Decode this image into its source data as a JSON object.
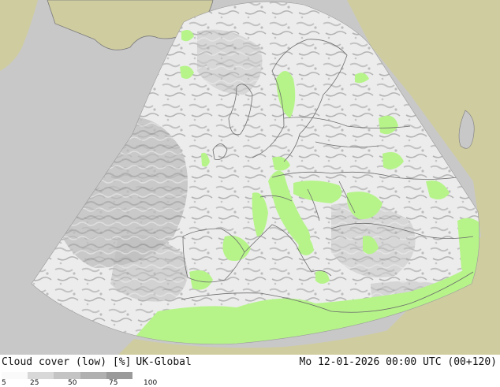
{
  "title": "Cloud cover (low) [%]",
  "model": "UK-Global",
  "datetime": "Mo 12-01-2026 00:00 UTC (00+120)",
  "legend": {
    "labels": [
      "5",
      "25",
      "50",
      "75",
      "100"
    ],
    "colors": [
      "#fafafa",
      "#d8d8d8",
      "#c4c4c4",
      "#b0b0b0",
      "#9a9a9a"
    ]
  },
  "colors": {
    "ocean_outside": "#c8c8c8",
    "land_outside": "#cfcca0",
    "cloud_light": "#ececec",
    "cloud_dense": "#a8a8a8",
    "clear_land": "#b6f48a",
    "borders": "#6c6c6c"
  }
}
